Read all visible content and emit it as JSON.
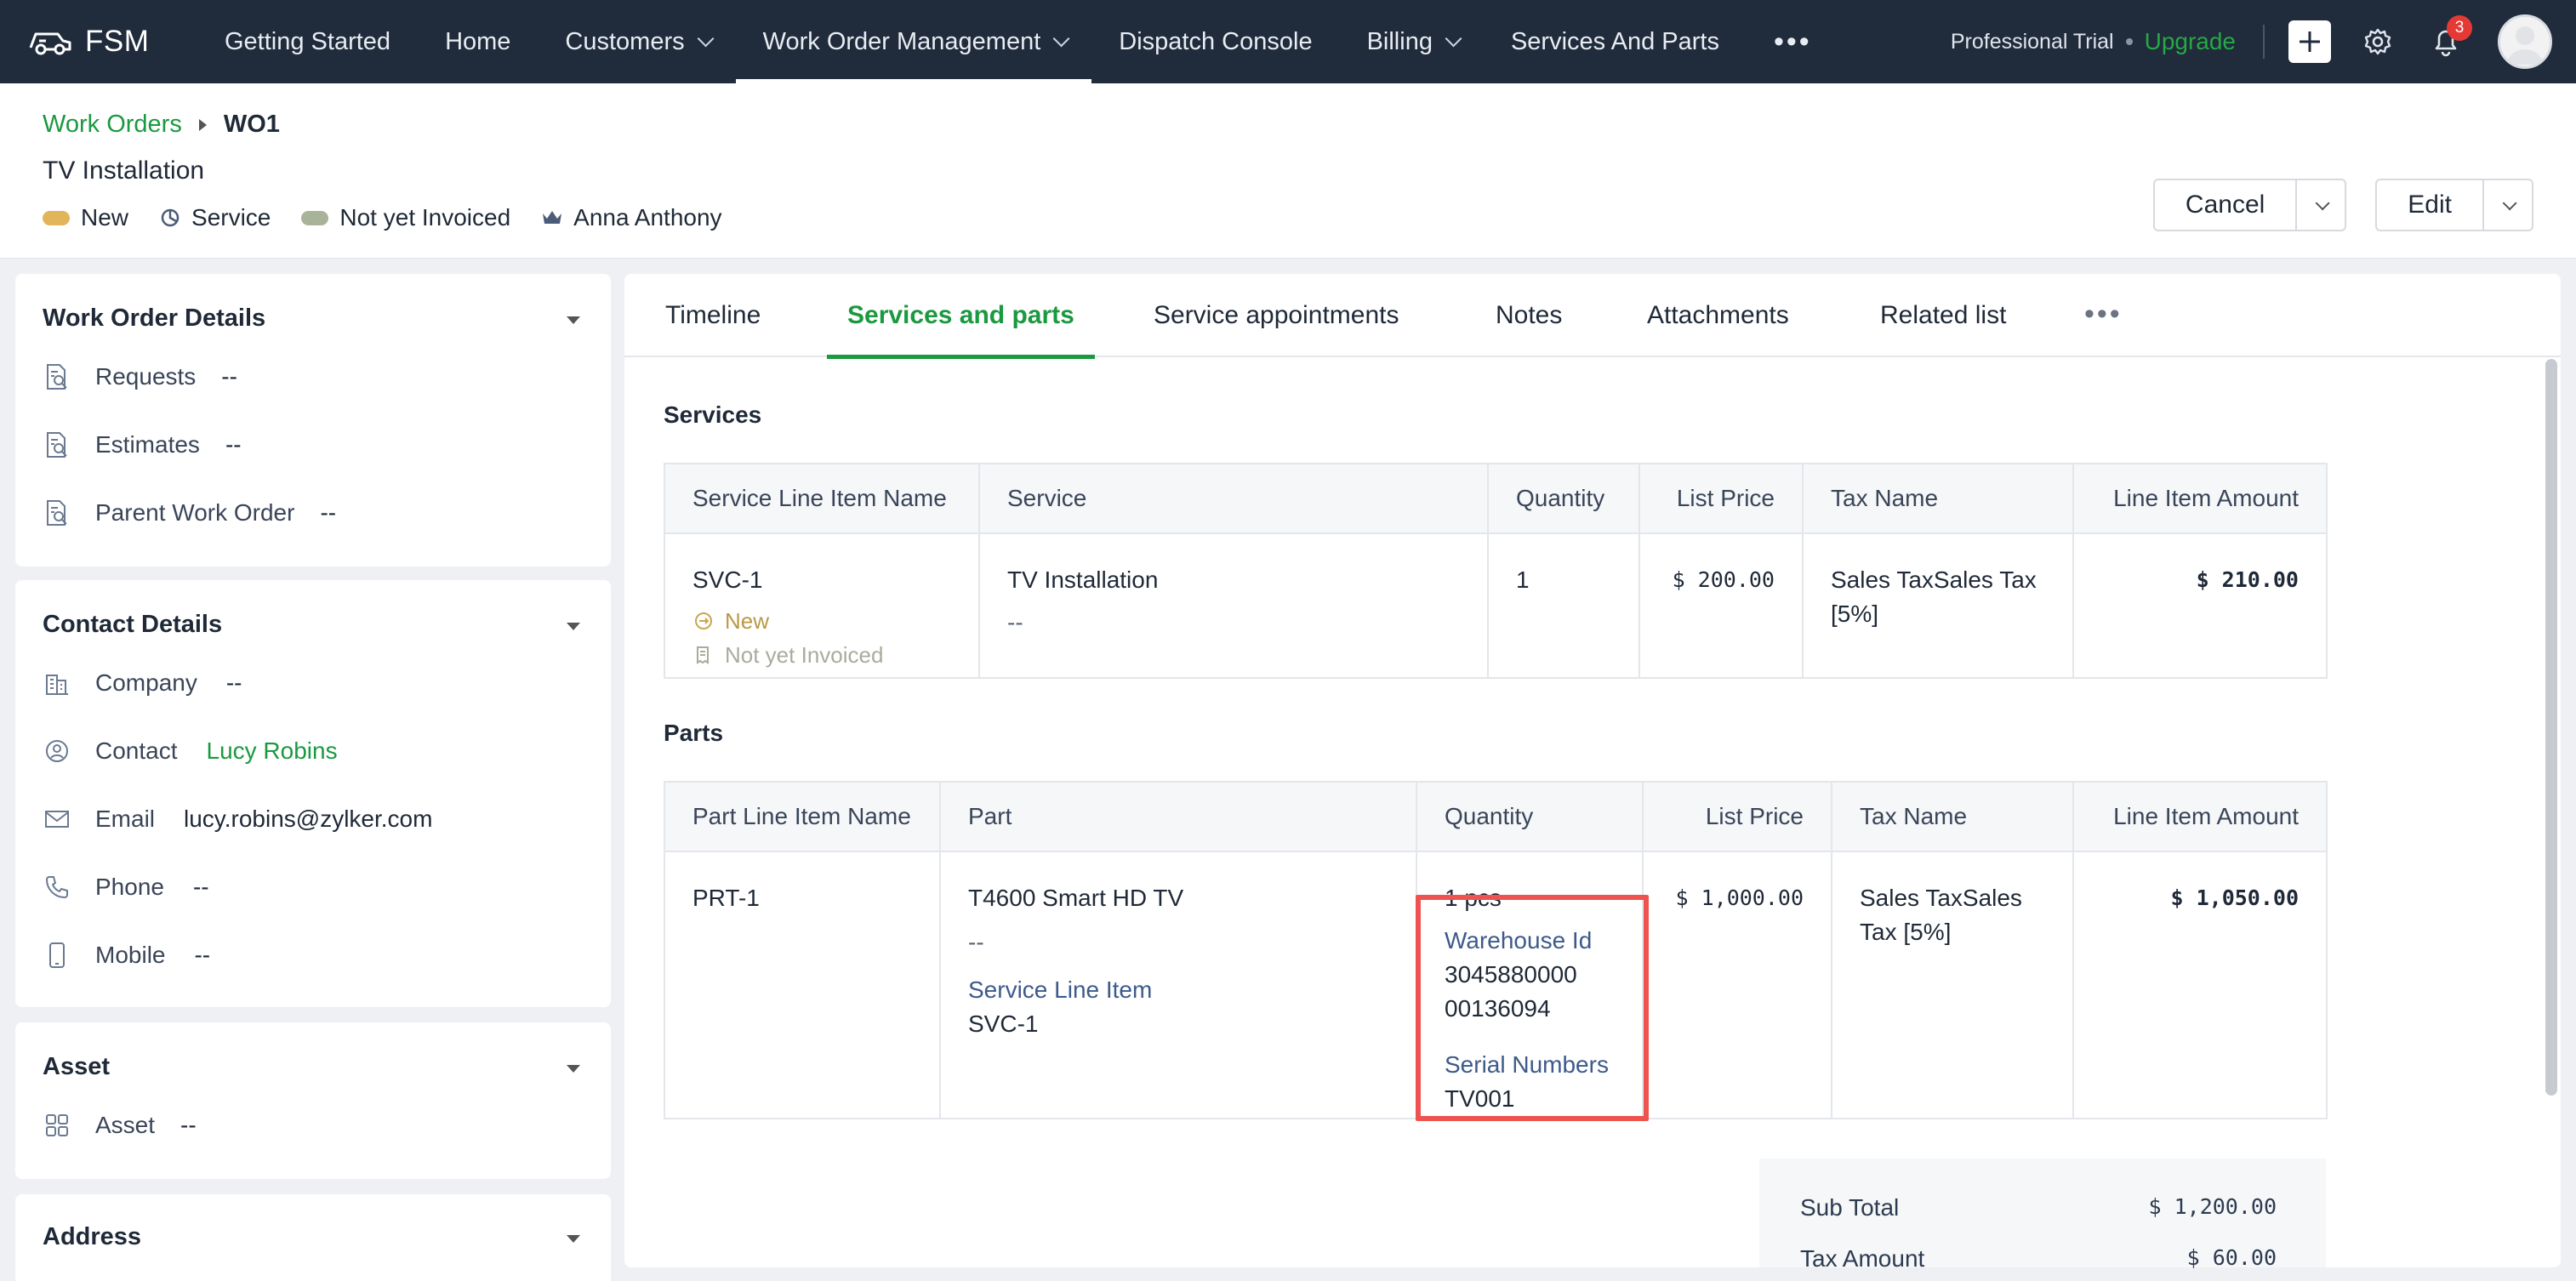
{
  "nav": {
    "brand": "FSM",
    "items": [
      {
        "label": "Getting Started"
      },
      {
        "label": "Home"
      },
      {
        "label": "Customers"
      },
      {
        "label": "Work Order Management"
      },
      {
        "label": "Dispatch Console"
      },
      {
        "label": "Billing"
      },
      {
        "label": "Services And Parts"
      }
    ],
    "more": "•••",
    "trial": "Professional Trial",
    "upgrade": "Upgrade",
    "notification_count": "3"
  },
  "header": {
    "breadcrumb_parent": "Work Orders",
    "breadcrumb_current": "WO1",
    "title": "TV Installation",
    "status": {
      "state": "New",
      "type": "Service",
      "invoice": "Not yet Invoiced",
      "owner": "Anna Anthony"
    },
    "cancel_label": "Cancel",
    "edit_label": "Edit"
  },
  "sidebar": {
    "work_order_details": {
      "title": "Work Order Details",
      "rows": [
        {
          "label": "Requests",
          "value": "--"
        },
        {
          "label": "Estimates",
          "value": "--"
        },
        {
          "label": "Parent Work Order",
          "value": "--"
        }
      ]
    },
    "contact_details": {
      "title": "Contact Details",
      "rows": [
        {
          "label": "Company",
          "value": "--"
        },
        {
          "label": "Contact",
          "value": "Lucy Robins"
        },
        {
          "label": "Email",
          "value": "lucy.robins@zylker.com"
        },
        {
          "label": "Phone",
          "value": "--"
        },
        {
          "label": "Mobile",
          "value": "--"
        }
      ]
    },
    "asset": {
      "title": "Asset",
      "rows": [
        {
          "label": "Asset",
          "value": "--"
        }
      ]
    },
    "address": {
      "title": "Address"
    }
  },
  "tabs": [
    {
      "label": "Timeline"
    },
    {
      "label": "Services and parts"
    },
    {
      "label": "Service appointments"
    },
    {
      "label": "Notes"
    },
    {
      "label": "Attachments"
    },
    {
      "label": "Related list"
    }
  ],
  "tabs_more": "•••",
  "services": {
    "title": "Services",
    "columns": [
      "Service Line Item Name",
      "Service",
      "Quantity",
      "List Price",
      "Tax Name",
      "Line Item Amount"
    ],
    "rows": [
      {
        "name": "SVC-1",
        "status": "New",
        "invoice": "Not yet Invoiced",
        "service": "TV Installation",
        "service_sub": "--",
        "quantity": "1",
        "list_price": "$ 200.00",
        "tax_name": "Sales TaxSales Tax [5%]",
        "amount": "$ 210.00"
      }
    ]
  },
  "parts": {
    "title": "Parts",
    "columns": [
      "Part Line Item Name",
      "Part",
      "Quantity",
      "List Price",
      "Tax Name",
      "Line Item Amount"
    ],
    "rows": [
      {
        "name": "PRT-1",
        "part": "T4600 Smart HD TV",
        "part_sub": "--",
        "service_line_item_label": "Service Line Item",
        "service_line_item": "SVC-1",
        "quantity": "1 pcs",
        "warehouse_label": "Warehouse Id",
        "warehouse_line1": "3045880000",
        "warehouse_line2": "00136094",
        "serial_label": "Serial Numbers",
        "serial": "TV001",
        "list_price": "$ 1,000.00",
        "tax_line1": "Sales TaxSales",
        "tax_line2": "Tax [5%]",
        "amount": "$ 1,050.00"
      }
    ]
  },
  "summary": {
    "sub_total_label": "Sub Total",
    "sub_total": "$ 1,200.00",
    "tax_amount_label": "Tax Amount",
    "tax_amount": "$ 60.00"
  },
  "colors": {
    "nav_bg": "#202b3b",
    "accent_green": "#1a9940",
    "highlight_red": "#ef5350",
    "status_new": "#e2b55a",
    "status_invoice": "#a9b39a"
  }
}
